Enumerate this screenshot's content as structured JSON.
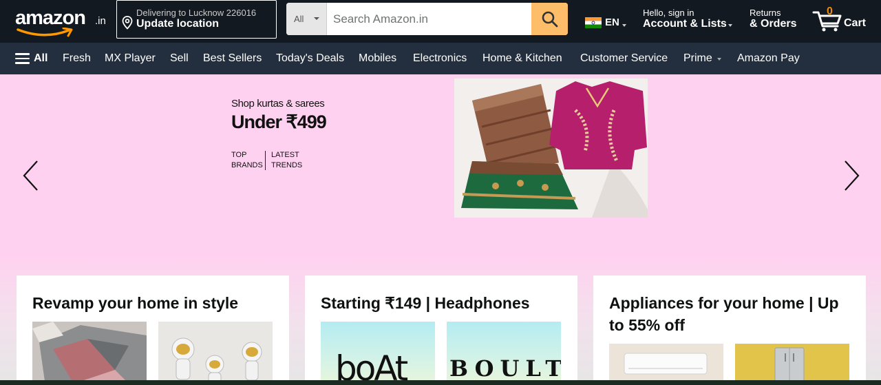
{
  "header": {
    "logo_text": "amazon",
    "logo_tld": ".in",
    "deliver_line1": "Delivering to Lucknow 226016",
    "deliver_line2": "Update location",
    "search_category": "All",
    "search_placeholder": "Search Amazon.in",
    "language_code": "EN",
    "account_line1": "Hello, sign in",
    "account_line2": "Account & Lists",
    "returns_line1": "Returns",
    "returns_line2": "& Orders",
    "cart_count": "0",
    "cart_label": "Cart"
  },
  "subnav": {
    "all_label": "All",
    "links": [
      "Fresh",
      "MX Player",
      "Sell",
      "Best Sellers",
      "Today's Deals",
      "Mobiles",
      "Electronics",
      "Home & Kitchen",
      "Customer Service",
      "Prime",
      "Amazon Pay"
    ]
  },
  "hero": {
    "sub": "Shop kurtas & sarees",
    "headline": "Under ₹499",
    "tag1": "TOP BRANDS",
    "tag2": "LATEST TRENDS"
  },
  "cards": [
    {
      "title": "Revamp your home in style"
    },
    {
      "title": "Starting ₹149 | Headphones",
      "brand1": "boAt",
      "brand2": "BOULT"
    },
    {
      "title": "Appliances for your home | Up to 55% off"
    }
  ],
  "colors": {
    "nav_dark": "#131921",
    "nav_sub": "#232f3e",
    "search_button": "#febd69",
    "cart_count": "#f08804",
    "hero_bg": "#ffd1f0"
  }
}
